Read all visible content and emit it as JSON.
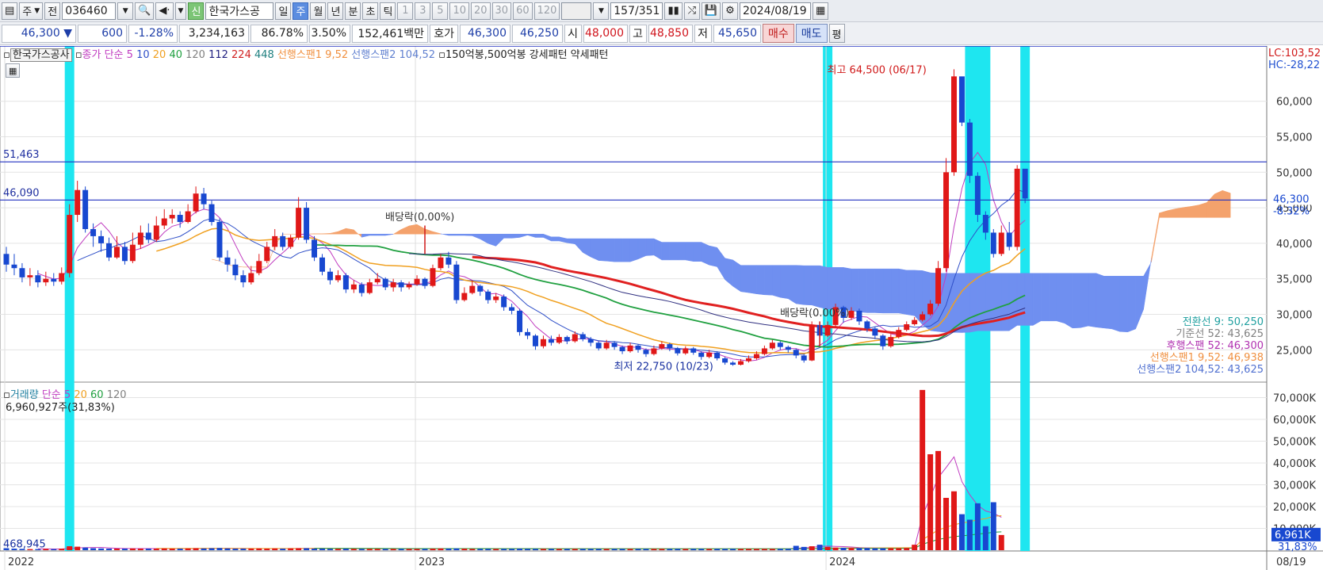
{
  "toolbar": {
    "period_select": "주",
    "prev_label": "전",
    "code": "036460",
    "new_badge": "신",
    "stock_name": "한국가스공",
    "periods": [
      "일",
      "주",
      "월",
      "년",
      "분",
      "초",
      "틱"
    ],
    "selected_period": "주",
    "intervals": [
      "1",
      "3",
      "5",
      "10",
      "20",
      "30",
      "60",
      "120"
    ],
    "count": "157",
    "count_total": "/351",
    "date": "2024/08/19"
  },
  "quote": {
    "price": "46,300",
    "arrow": "▼",
    "change": "600",
    "change_pct": "-1.28%",
    "volume": "3,234,163",
    "vol_ratio": "86.78%",
    "turnover": "3.50%",
    "amount": "152,461백만",
    "bid_label": "호가",
    "ask": "46,300",
    "bid": "46,250",
    "open_label": "시",
    "open": "48,000",
    "high_label": "고",
    "high": "48,850",
    "low_label": "저",
    "low": "45,650",
    "buy_label": "매수",
    "sell_label": "매도",
    "eval_label": "평"
  },
  "price_legend": {
    "name": "한국가스공사",
    "ma_label": "종가 단순",
    "ma_periods": [
      "5",
      "10",
      "20",
      "40",
      "120",
      "112",
      "224",
      "448"
    ],
    "ma_colors": [
      "#c03cc0",
      "#3050c8",
      "#f0a020",
      "#20a040",
      "#808080",
      "#202080",
      "#d02020",
      "#208080"
    ],
    "span1": "선행스팬1 9,52",
    "span2": "선행스팬2 104,52",
    "pattern": "150억봉,500억봉 강세패턴  약세패턴"
  },
  "price_axis": {
    "ticks": [
      "60,000",
      "55,000",
      "50,000",
      "45,000",
      "40,000",
      "35,000",
      "30,000",
      "25,000"
    ],
    "lc": "LC:103,52",
    "hc": "HC:-28,22",
    "current": "46,300",
    "current_pct": "-8.32%"
  },
  "hlines": [
    {
      "label": "51,463"
    },
    {
      "label": "46,090"
    }
  ],
  "annotations": {
    "high": "최고 64,500 (06/17)",
    "low": "최저 22,750 (10/23)",
    "div1": "배당락(0.00%)",
    "div2": "배당락(0.00%)"
  },
  "ichimoku_values": [
    {
      "text": "전환선 9: 50,250",
      "color": "#20a0a0"
    },
    {
      "text": "기준선 52: 43,625",
      "color": "#808080"
    },
    {
      "text": "후행스팬 52: 46,300",
      "color": "#b030b0"
    },
    {
      "text": "선행스팬1 9,52: 46,938",
      "color": "#f09040"
    },
    {
      "text": "선행스팬2 104,52: 43,625",
      "color": "#5070d0"
    }
  ],
  "volume_legend": {
    "label": "거래량",
    "ma_label": "단순",
    "ma_periods": [
      "5",
      "20",
      "60",
      "120"
    ],
    "ma_colors": [
      "#c03cc0",
      "#f0a020",
      "#20a040",
      "#808080"
    ],
    "value": "6,960,927주(31,83%)"
  },
  "volume_axis": {
    "ticks": [
      "70,000K",
      "60,000K",
      "50,000K",
      "40,000K",
      "30,000K",
      "20,000K",
      "10,000K"
    ],
    "current": "6,961K",
    "current_pct": "31,83%",
    "left_label": "468,945"
  },
  "x_axis": {
    "labels": [
      "2022",
      "2023",
      "2024"
    ],
    "right": "08/19"
  },
  "chart_data": {
    "type": "candlestick",
    "x_start": "2022-01",
    "price_candles": [
      [
        38500,
        37000,
        39500,
        36000
      ],
      [
        37000,
        36500,
        38500,
        35500
      ],
      [
        36500,
        35200,
        37200,
        34500
      ],
      [
        35200,
        35500,
        36500,
        34000
      ],
      [
        35500,
        34500,
        36200,
        33800
      ],
      [
        34500,
        35000,
        36000,
        34000
      ],
      [
        35000,
        34600,
        35800,
        34000
      ],
      [
        34600,
        35800,
        36600,
        34200
      ],
      [
        35800,
        44000,
        45500,
        35200
      ],
      [
        44000,
        47500,
        48800,
        43000
      ],
      [
        47500,
        42000,
        48000,
        41500
      ],
      [
        42000,
        41000,
        42800,
        39500
      ],
      [
        41000,
        40000,
        41800,
        38800
      ],
      [
        40000,
        38000,
        40800,
        37500
      ],
      [
        38000,
        39500,
        41000,
        37800
      ],
      [
        39500,
        37500,
        40200,
        37000
      ],
      [
        37500,
        39800,
        41500,
        37200
      ],
      [
        39800,
        41500,
        42500,
        39200
      ],
      [
        41500,
        40500,
        42800,
        40000
      ],
      [
        40500,
        42500,
        43800,
        40200
      ],
      [
        42500,
        43500,
        44800,
        42000
      ],
      [
        43500,
        44000,
        44800,
        42800
      ],
      [
        44000,
        43000,
        44500,
        42200
      ],
      [
        43000,
        44500,
        45500,
        42800
      ],
      [
        44500,
        47000,
        48000,
        44200
      ],
      [
        47000,
        45500,
        47800,
        44800
      ],
      [
        45500,
        43000,
        46000,
        42500
      ],
      [
        43000,
        38000,
        43500,
        37500
      ],
      [
        38000,
        37000,
        39000,
        36000
      ],
      [
        37000,
        35500,
        37800,
        34800
      ],
      [
        35500,
        34500,
        36200,
        33800
      ],
      [
        34500,
        35800,
        36800,
        34200
      ],
      [
        35800,
        37500,
        38500,
        35500
      ],
      [
        37500,
        39500,
        40200,
        37200
      ],
      [
        39500,
        41000,
        42000,
        39000
      ],
      [
        41000,
        39500,
        41500,
        39000
      ],
      [
        39500,
        40800,
        41200,
        39200
      ],
      [
        40800,
        45000,
        46500,
        40500
      ],
      [
        45000,
        40500,
        45800,
        40000
      ],
      [
        40500,
        38000,
        41000,
        37500
      ],
      [
        38000,
        36000,
        38500,
        35500
      ],
      [
        36000,
        34800,
        36500,
        34200
      ],
      [
        34800,
        35500,
        36200,
        34500
      ],
      [
        35500,
        33500,
        35800,
        33000
      ],
      [
        33500,
        34200,
        34800,
        33000
      ],
      [
        34200,
        33000,
        34500,
        32500
      ],
      [
        33000,
        34500,
        35000,
        32800
      ],
      [
        34500,
        35000,
        35800,
        34200
      ],
      [
        35000,
        33800,
        35200,
        33400
      ],
      [
        33800,
        34500,
        35000,
        33200
      ],
      [
        34500,
        33800,
        34800,
        33200
      ],
      [
        33800,
        34200,
        34600,
        33500
      ],
      [
        34200,
        35000,
        35500,
        34000
      ],
      [
        35000,
        34000,
        35200,
        33600
      ],
      [
        34000,
        36500,
        37000,
        33800
      ],
      [
        36500,
        38000,
        38500,
        36200
      ],
      [
        38000,
        37000,
        38800,
        36500
      ],
      [
        37000,
        32000,
        37500,
        31500
      ],
      [
        32000,
        33000,
        33800,
        31800
      ],
      [
        33000,
        34000,
        34800,
        32800
      ],
      [
        34000,
        33200,
        34200,
        32600
      ],
      [
        33200,
        32000,
        33500,
        31500
      ],
      [
        32000,
        32500,
        33000,
        31600
      ],
      [
        32500,
        31000,
        32800,
        30500
      ],
      [
        31000,
        30500,
        31500,
        30000
      ],
      [
        30500,
        27500,
        30800,
        27000
      ],
      [
        27500,
        27000,
        28000,
        26500
      ],
      [
        27000,
        25500,
        27200,
        25000
      ],
      [
        25500,
        26500,
        27000,
        25200
      ],
      [
        26500,
        26000,
        27000,
        25600
      ],
      [
        26000,
        26800,
        27200,
        25800
      ],
      [
        26800,
        26200,
        27000,
        25800
      ],
      [
        26200,
        27200,
        27600,
        26000
      ],
      [
        27200,
        26500,
        27500,
        26200
      ],
      [
        26500,
        26000,
        26800,
        25500
      ],
      [
        26000,
        25200,
        26200,
        24900
      ],
      [
        25200,
        26000,
        26400,
        25000
      ],
      [
        26000,
        25400,
        26200,
        25000
      ],
      [
        25400,
        24800,
        25600,
        24400
      ],
      [
        24800,
        25600,
        26000,
        24600
      ],
      [
        25600,
        25000,
        25800,
        24600
      ],
      [
        25000,
        24400,
        25200,
        24000
      ],
      [
        24400,
        25200,
        25600,
        24200
      ],
      [
        25200,
        25800,
        26200,
        25000
      ],
      [
        25800,
        25200,
        26000,
        24800
      ],
      [
        25200,
        24500,
        25400,
        24200
      ],
      [
        24500,
        25200,
        25500,
        24300
      ],
      [
        25200,
        24600,
        25400,
        24300
      ],
      [
        24600,
        24000,
        24800,
        23600
      ],
      [
        24000,
        24600,
        25000,
        23800
      ],
      [
        24600,
        23800,
        24800,
        23500
      ],
      [
        23800,
        23200,
        24000,
        22900
      ],
      [
        23200,
        22900,
        23400,
        22750
      ],
      [
        22900,
        23400,
        23700,
        22800
      ],
      [
        23400,
        23800,
        24200,
        23200
      ],
      [
        23800,
        24400,
        24800,
        23600
      ],
      [
        24400,
        25200,
        25600,
        24200
      ],
      [
        25200,
        26000,
        26400,
        25000
      ],
      [
        26000,
        25400,
        26200,
        25000
      ],
      [
        25400,
        25000,
        25600,
        24600
      ],
      [
        25000,
        24200,
        25200,
        23800
      ],
      [
        24200,
        23500,
        24400,
        23200
      ],
      [
        23500,
        28500,
        29000,
        23400
      ],
      [
        28500,
        27000,
        28800,
        26500
      ],
      [
        27000,
        28500,
        29000,
        26800
      ],
      [
        28500,
        31000,
        31500,
        28200
      ],
      [
        31000,
        29500,
        31200,
        28800
      ],
      [
        29500,
        30500,
        31000,
        29200
      ],
      [
        30500,
        29000,
        30800,
        28500
      ],
      [
        29000,
        28000,
        29200,
        27500
      ],
      [
        28000,
        27000,
        28200,
        26500
      ],
      [
        27000,
        25500,
        27200,
        25000
      ],
      [
        25500,
        26800,
        27200,
        25300
      ],
      [
        26800,
        27800,
        28200,
        26600
      ],
      [
        27800,
        28600,
        29000,
        27600
      ],
      [
        28600,
        29200,
        29600,
        28400
      ],
      [
        29200,
        30000,
        30400,
        29000
      ],
      [
        30000,
        31500,
        32000,
        29800
      ],
      [
        31500,
        36500,
        37500,
        31200
      ],
      [
        36500,
        50000,
        52000,
        36000
      ],
      [
        50000,
        63500,
        64500,
        49500
      ],
      [
        63500,
        57000,
        63000,
        56500
      ],
      [
        57000,
        49500,
        57500,
        48500
      ],
      [
        49500,
        44000,
        50000,
        43000
      ],
      [
        44000,
        41500,
        44500,
        40500
      ],
      [
        41500,
        38500,
        42000,
        38000
      ],
      [
        38500,
        41500,
        42500,
        38200
      ],
      [
        41500,
        39500,
        43000,
        39000
      ],
      [
        39500,
        50500,
        51000,
        39000
      ],
      [
        50500,
        46300,
        48850,
        45650
      ]
    ],
    "high_marker": {
      "label": "최고 64,500 (06/17)",
      "value": 64500
    },
    "low_marker": {
      "label": "최저 22,750 (10/23)",
      "value": 22750
    },
    "volume_k": [
      900,
      700,
      600,
      500,
      500,
      600,
      500,
      700,
      1800,
      1600,
      1200,
      900,
      800,
      700,
      700,
      700,
      800,
      700,
      700,
      700,
      800,
      700,
      700,
      800,
      900,
      800,
      900,
      1000,
      800,
      700,
      700,
      700,
      800,
      700,
      800,
      700,
      800,
      900,
      900,
      700,
      700,
      600,
      600,
      700,
      600,
      600,
      600,
      600,
      600,
      600,
      600,
      600,
      600,
      600,
      700,
      800,
      700,
      800,
      700,
      600,
      600,
      600,
      600,
      600,
      600,
      700,
      600,
      600,
      600,
      600,
      600,
      600,
      600,
      600,
      600,
      600,
      600,
      600,
      600,
      600,
      600,
      600,
      600,
      600,
      600,
      600,
      600,
      600,
      600,
      600,
      600,
      600,
      600,
      600,
      600,
      600,
      600,
      600,
      600,
      600,
      2000,
      1500,
      1800,
      2500,
      1500,
      1200,
      1100,
      1000,
      1000,
      1000,
      900,
      900,
      900,
      900,
      1000,
      2500,
      73500,
      44000,
      45500,
      24000,
      27000,
      16500,
      14000,
      21500,
      11000,
      22000,
      6961
    ]
  }
}
